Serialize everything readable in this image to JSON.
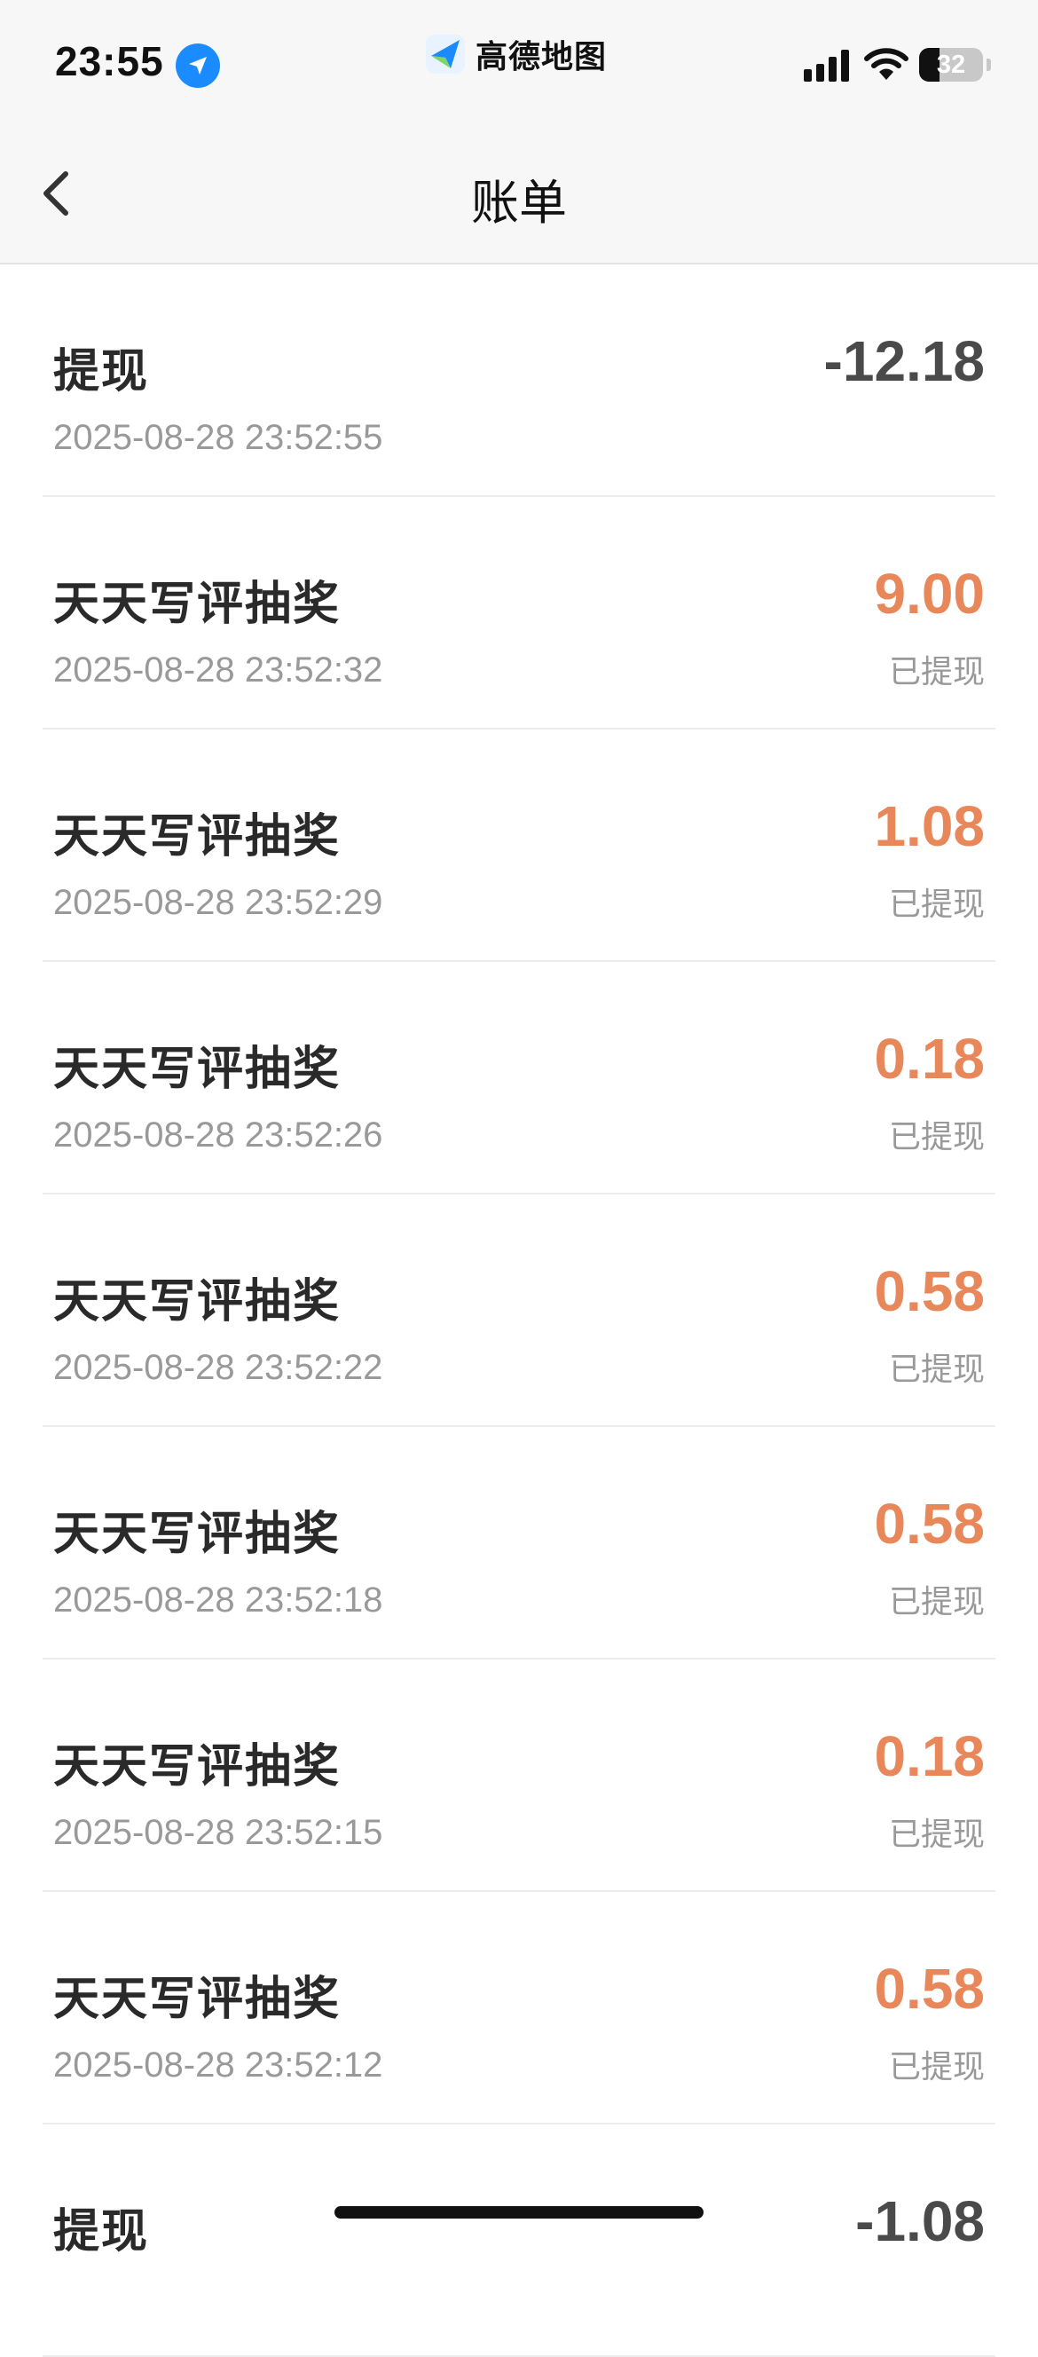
{
  "status_bar": {
    "time": "23:55",
    "app_name": "高德地图",
    "battery": "32",
    "battery_level": 0.32,
    "icons": [
      "location-arrow-icon",
      "signal-icon",
      "wifi-icon",
      "battery-icon"
    ]
  },
  "nav": {
    "title": "账单",
    "back_icon": "chevron-left-icon"
  },
  "colors": {
    "income": "#e8875a",
    "withdraw": "#4a4a4a",
    "muted": "#999999"
  },
  "bills": [
    {
      "title": "提现",
      "time": "2025-08-28 23:52:55",
      "amount": "-12.18",
      "status": "",
      "type": "withdraw"
    },
    {
      "title": "天天写评抽奖",
      "time": "2025-08-28 23:52:32",
      "amount": "9.00",
      "status": "已提现",
      "type": "income"
    },
    {
      "title": "天天写评抽奖",
      "time": "2025-08-28 23:52:29",
      "amount": "1.08",
      "status": "已提现",
      "type": "income"
    },
    {
      "title": "天天写评抽奖",
      "time": "2025-08-28 23:52:26",
      "amount": "0.18",
      "status": "已提现",
      "type": "income"
    },
    {
      "title": "天天写评抽奖",
      "time": "2025-08-28 23:52:22",
      "amount": "0.58",
      "status": "已提现",
      "type": "income"
    },
    {
      "title": "天天写评抽奖",
      "time": "2025-08-28 23:52:18",
      "amount": "0.58",
      "status": "已提现",
      "type": "income"
    },
    {
      "title": "天天写评抽奖",
      "time": "2025-08-28 23:52:15",
      "amount": "0.18",
      "status": "已提现",
      "type": "income"
    },
    {
      "title": "天天写评抽奖",
      "time": "2025-08-28 23:52:12",
      "amount": "0.58",
      "status": "已提现",
      "type": "income"
    },
    {
      "title": "提现",
      "time": "",
      "amount": "-1.08",
      "status": "",
      "type": "withdraw"
    }
  ]
}
